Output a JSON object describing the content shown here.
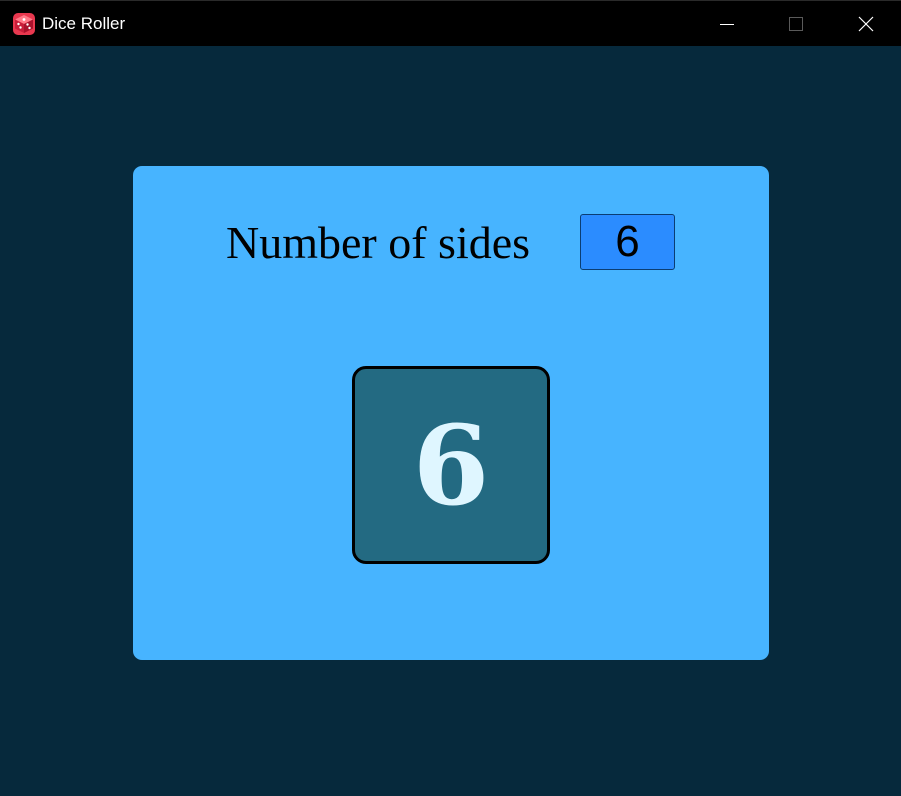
{
  "window": {
    "title": "Dice Roller",
    "controls": {
      "minimize": "minimize-icon",
      "maximize": "maximize-icon",
      "close": "close-icon"
    }
  },
  "panel": {
    "sides_label": "Number of sides",
    "sides_value": "6",
    "roll_result": "6"
  },
  "colors": {
    "window_background": "#06293c",
    "panel_background": "#47b4ff",
    "input_background": "#2b8cff",
    "dice_background": "#236a82",
    "dice_text": "#dff6ff"
  }
}
